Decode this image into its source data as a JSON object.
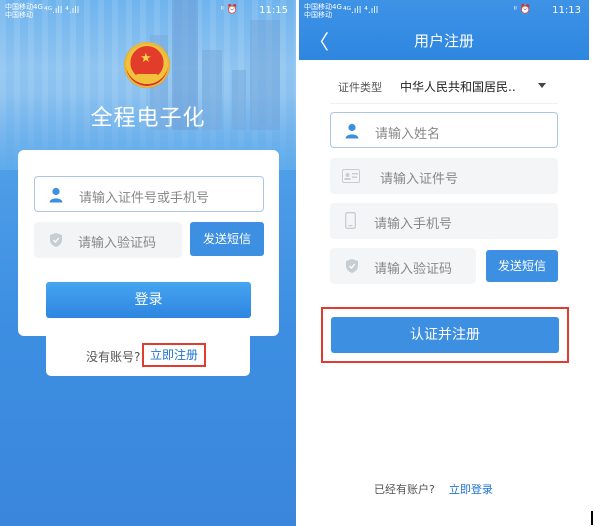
{
  "left": {
    "status": {
      "carrier1": "中国移动4G",
      "carrier2": "中国移动",
      "signal": "⁴ᴳ.ıll ⁴.ıll",
      "icons": "ᵎᵎ ⏰",
      "time": "11:15"
    },
    "app_title": "全程电子化",
    "account_placeholder": "请输入证件号或手机号",
    "code_placeholder": "请输入验证码",
    "sms_button": "发送短信",
    "login_button": "登录",
    "no_account": "没有账号?",
    "register_link": "立即注册"
  },
  "right": {
    "status": {
      "carrier1": "中国移动4G",
      "carrier2": "中国移动",
      "signal": "⁴ᴳ.ıll ⁴.ıll",
      "icons": "ᵎᵎ ⏰",
      "time": "11:13"
    },
    "title": "用户注册",
    "id_type_label": "证件类型",
    "id_type_value": "中华人民共和国居民..",
    "name_placeholder": "请输入姓名",
    "id_placeholder": "请输入证件号",
    "phone_placeholder": "请输入手机号",
    "code_placeholder": "请输入验证码",
    "sms_button": "发送短信",
    "verify_button": "认证并注册",
    "have_account": "已经有账户?",
    "login_link": "立即登录"
  },
  "colors": {
    "primary": "#3d8fe2",
    "highlight_border": "#e23b30",
    "link": "#1f72d3"
  },
  "icons": [
    "person-icon",
    "shield-icon",
    "id-card-icon",
    "phone-icon",
    "caret-down-icon",
    "back-icon",
    "emblem-icon"
  ]
}
